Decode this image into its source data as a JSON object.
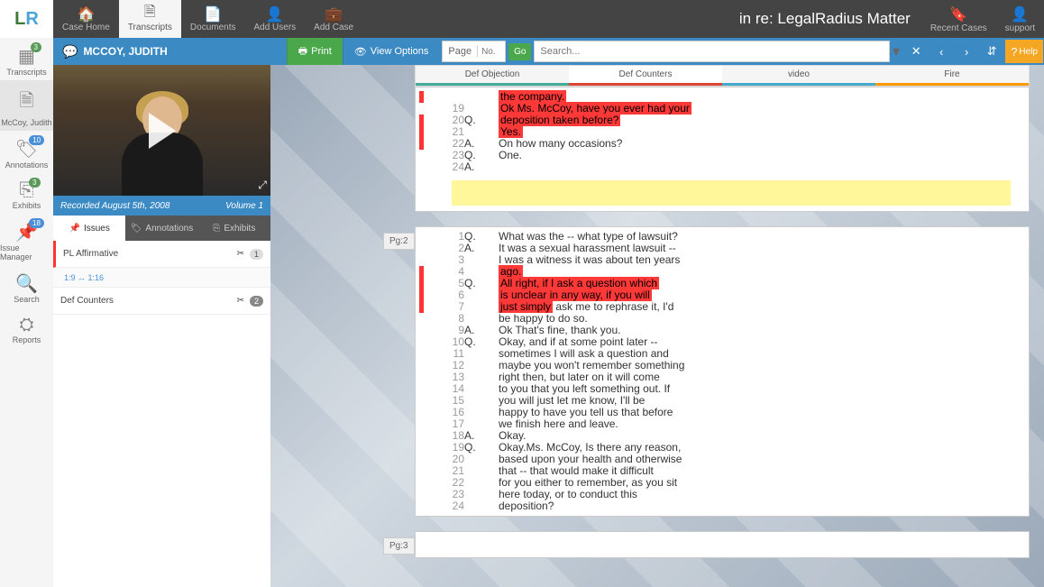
{
  "logo": {
    "l": "L",
    "r": "R"
  },
  "nav": {
    "case_home": "Case Home",
    "transcripts": "Transcripts",
    "documents": "Documents",
    "add_users": "Add Users",
    "add_case": "Add Case"
  },
  "matter_title": "in re: LegalRadius Matter",
  "recent_cases": "Recent Cases",
  "support": "support",
  "rail": {
    "transcripts": "Transcripts",
    "transcripts_badge": "3",
    "witness": "McCoy, Judith",
    "annotations": "Annotations",
    "annotations_badge": "10",
    "exhibits": "Exhibits",
    "exhibits_badge": "3",
    "issue_manager": "Issue Manager",
    "issue_manager_badge": "18",
    "search": "Search",
    "reports": "Reports"
  },
  "subheader": {
    "witness": "MCCOY, JUDITH",
    "print": "Print",
    "view_options": "View Options",
    "page_label": "Page",
    "page_placeholder": "No.",
    "go": "Go",
    "search_placeholder": "Search...",
    "help": "Help"
  },
  "video": {
    "recorded": "Recorded August 5th, 2008",
    "volume": "Volume 1"
  },
  "side_tabs": {
    "issues": "Issues",
    "annotations": "Annotations",
    "exhibits": "Exhibits"
  },
  "issues": [
    {
      "name": "PL Affirmative",
      "count": "1",
      "sub": "1:9 ↔ 1:16"
    },
    {
      "name": "Def Counters",
      "count": "2"
    }
  ],
  "cat_tabs": [
    "Def Objection",
    "Def Counters",
    "video",
    "Fire"
  ],
  "pages": [
    {
      "label": "",
      "lines": [
        {
          "n": "",
          "sp": "",
          "t": "the company.",
          "hl": true
        },
        {
          "n": "19",
          "sp": "",
          "t": "",
          "hl": false
        },
        {
          "n": "20",
          "sp": "Q.",
          "t": "Ok Ms. McCoy, have you ever had your",
          "hl": true
        },
        {
          "n": "21",
          "sp": "",
          "t": "deposition taken before?",
          "hl": true
        },
        {
          "n": "22",
          "sp": "A.",
          "t": "Yes.",
          "hl": true
        },
        {
          "n": "23",
          "sp": "Q.",
          "t": "On how many occasions?",
          "hl": false
        },
        {
          "n": "24",
          "sp": "A.",
          "t": "One.",
          "hl": false
        }
      ],
      "note": true
    },
    {
      "label": "Pg:2",
      "lines": [
        {
          "n": " 1",
          "sp": "Q.",
          "t": "What was the -- what type of lawsuit?",
          "hl": false
        },
        {
          "n": " 2",
          "sp": "A.",
          "t": "It was a sexual harassment lawsuit --",
          "hl": false
        },
        {
          "n": " 3",
          "sp": "",
          "t": "I was a witness it was about ten years",
          "hl": false
        },
        {
          "n": " 4",
          "sp": "",
          "t": "ago.",
          "hl": true
        },
        {
          "n": " 5",
          "sp": "Q.",
          "t": "All right, if I ask a question which",
          "hl": true
        },
        {
          "n": " 6",
          "sp": "",
          "t": "is unclear in any way, if you will",
          "hl": true
        },
        {
          "n": " 7",
          "sp": "",
          "t": "just simply ask me to rephrase it, I'd",
          "hl": "partial"
        },
        {
          "n": " 8",
          "sp": "",
          "t": "be happy to do so.",
          "hl": false
        },
        {
          "n": " 9",
          "sp": "A.",
          "t": "Ok That's fine, thank you.",
          "hl": false
        },
        {
          "n": "10",
          "sp": "Q.",
          "t": "Okay, and if at some point later --",
          "hl": false
        },
        {
          "n": "11",
          "sp": "",
          "t": "sometimes I will ask a question and",
          "hl": false
        },
        {
          "n": "12",
          "sp": "",
          "t": "maybe you won't remember something",
          "hl": false
        },
        {
          "n": "13",
          "sp": "",
          "t": "right then, but later on it will come",
          "hl": false
        },
        {
          "n": "14",
          "sp": "",
          "t": "to you that you left something out. If",
          "hl": false
        },
        {
          "n": "15",
          "sp": "",
          "t": "you will just let me know, I'll be",
          "hl": false
        },
        {
          "n": "16",
          "sp": "",
          "t": "happy to have you tell us that before",
          "hl": false
        },
        {
          "n": "17",
          "sp": "",
          "t": "we finish here and leave.",
          "hl": false
        },
        {
          "n": "18",
          "sp": "A.",
          "t": "Okay.",
          "hl": false
        },
        {
          "n": "19",
          "sp": "Q.",
          "t": "Okay.Ms. McCoy, Is there any reason,",
          "hl": false
        },
        {
          "n": "20",
          "sp": "",
          "t": "based upon your health and otherwise",
          "hl": false
        },
        {
          "n": "21",
          "sp": "",
          "t": "that -- that would make it difficult",
          "hl": false
        },
        {
          "n": "22",
          "sp": "",
          "t": "for you either to remember, as you sit",
          "hl": false
        },
        {
          "n": "23",
          "sp": "",
          "t": "here today, or to conduct this",
          "hl": false
        },
        {
          "n": "24",
          "sp": "",
          "t": "deposition?",
          "hl": false
        }
      ]
    },
    {
      "label": "Pg:3",
      "lines": []
    }
  ]
}
